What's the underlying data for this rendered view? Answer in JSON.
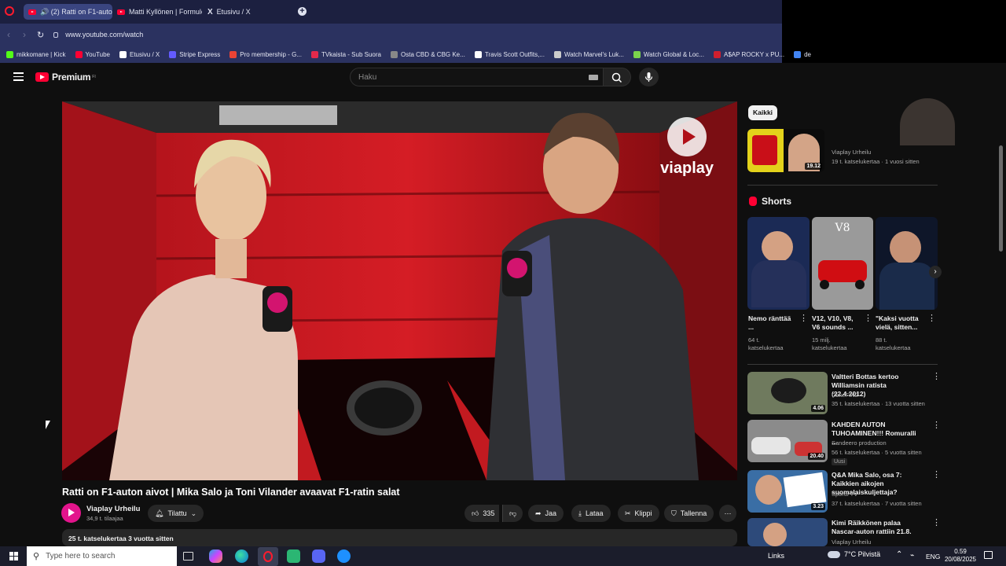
{
  "browser": {
    "tabs": [
      {
        "label": "🔊 (2) Ratti on F1-auton"
      },
      {
        "label": "Matti Kyllönen | Formulo"
      },
      {
        "label": "Etusivu / X"
      }
    ],
    "url": "www.youtube.com/watch",
    "bookmarks": [
      {
        "label": "mikkomane | Kick",
        "icon": "kick-icon",
        "color": "#53fc18"
      },
      {
        "label": "YouTube",
        "icon": "youtube-icon",
        "color": "#ff0033"
      },
      {
        "label": "Etusivu / X",
        "icon": "x-icon",
        "color": "#ffffff"
      },
      {
        "label": "Stripe Express",
        "icon": "stripe-icon",
        "color": "#635bff"
      },
      {
        "label": "Pro membership - G...",
        "icon": "pin-icon",
        "color": "#ea4335"
      },
      {
        "label": "TVkaista - Sub Suora",
        "icon": "tvkaista-icon",
        "color": "#e2294b"
      },
      {
        "label": "Osta CBD & CBG Ke...",
        "icon": "cbd-icon",
        "color": "#888888"
      },
      {
        "label": "Travis Scott Outfits,...",
        "icon": "travis-icon",
        "color": "#ffffff"
      },
      {
        "label": "Watch Marvel's Luk...",
        "icon": "marvel-icon",
        "color": "#cccccc"
      },
      {
        "label": "Watch Global & Loc...",
        "icon": "global-icon",
        "color": "#7bd34c"
      },
      {
        "label": "A$AP ROCKY x PU...",
        "icon": "puma-icon",
        "color": "#d01f2e"
      },
      {
        "label": "de",
        "icon": "de-icon",
        "color": "#4285f4"
      }
    ]
  },
  "youtube": {
    "logo": "Premium",
    "logo_sup": "FI",
    "search_placeholder": "Haku",
    "video": {
      "title": "Ratti on F1-auton aivot | Mika Salo ja Toni Vilander avaavat F1-ratin salat",
      "watermark": "viaplay",
      "channel": "Viaplay Urheilu",
      "subscribers": "34,9 t. tilaajaa",
      "subscribe_label": "Tilattu",
      "likes": "335",
      "share_label": "Jaa",
      "download_label": "Lataa",
      "clip_label": "Klippi",
      "save_label": "Tallenna",
      "desc_meta": "25 t. katselukertaa  3 vuotta sitten"
    },
    "chips": [
      "Kaikki"
    ],
    "top_related": {
      "channel": "Viaplay Urheilu",
      "meta": "19 t. katselukertaa · 1 vuosi sitten",
      "duration": "19.12"
    },
    "shorts": {
      "heading": "Shorts",
      "items": [
        {
          "title": "Nemo ränttää ...",
          "views": "64 t.",
          "views_label": "katselukertaa"
        },
        {
          "title": "V12, V10, V8, V6 sounds ...",
          "views": "15 milj.",
          "views_label": "katselukertaa",
          "thumb_text": "V8"
        },
        {
          "title": "\"Kaksi vuotta vielä, sitten...",
          "views": "88 t.",
          "views_label": "katselukertaa"
        }
      ]
    },
    "related": [
      {
        "title": "Valtteri Bottas kertoo Williamsin ratista (22.4.2012)",
        "channel": "CokeFIN2",
        "meta": "35 t. katselukertaa · 13 vuotta sitten",
        "duration": "4.06",
        "badge": ""
      },
      {
        "title": "KAHDEN AUTON TUHOAMINEN!!! Romuralli ...",
        "channel": "Sandeero production",
        "meta": "56 t. katselukertaa · 5 vuotta sitten",
        "duration": "20.40",
        "badge": "Uusi"
      },
      {
        "title": "Q&A Mika Salo, osa 7: Kaikkien aikojen suomalaiskuljettaja?",
        "channel": "Sportti TV",
        "meta": "37 t. katselukertaa · 7 vuotta sitten",
        "duration": "3.23",
        "badge": ""
      },
      {
        "title": "Kimi Räikkönen palaa Nascar-auton rattiin 21.8.",
        "channel": "Viaplay Urheilu",
        "meta": "",
        "duration": "",
        "badge": ""
      }
    ]
  },
  "taskbar": {
    "search_placeholder": "Type here to search",
    "links_label": "Links",
    "weather": "7°C  Pilvistä",
    "lang": "ENG",
    "time": "0.59",
    "date": "20/08/2025"
  }
}
